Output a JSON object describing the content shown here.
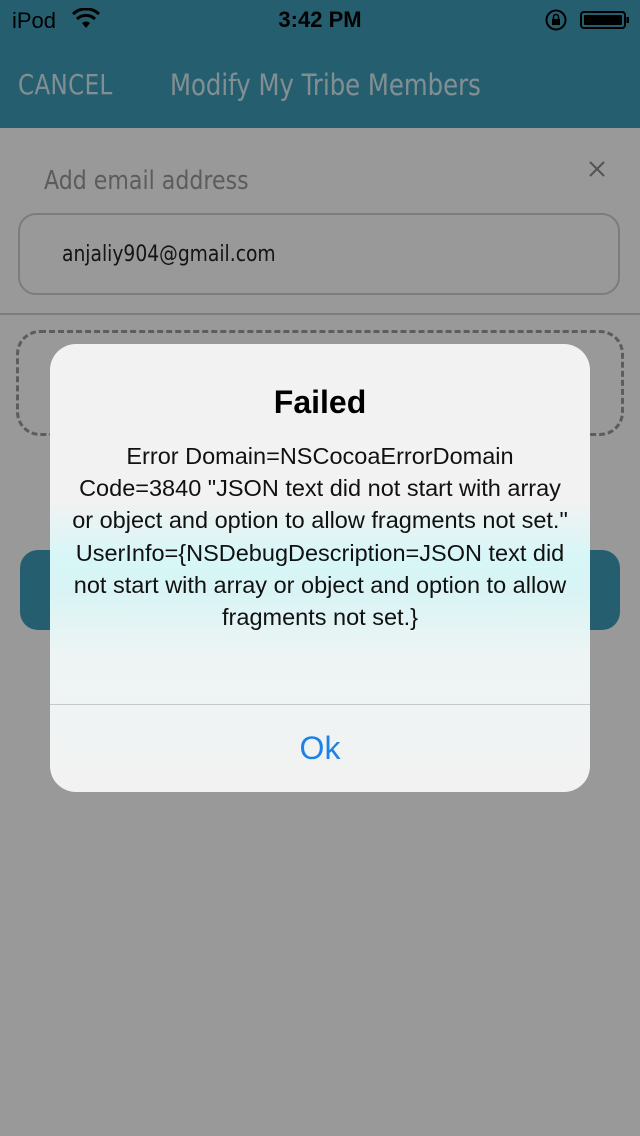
{
  "status_bar": {
    "carrier": "iPod",
    "time": "3:42 PM"
  },
  "nav": {
    "cancel_label": "CANCEL",
    "title": "Modify My Tribe Members"
  },
  "form": {
    "add_email_label": "Add email address",
    "email_value": "anjaliy904@gmail.com"
  },
  "alert": {
    "title": "Failed",
    "message": "Error Domain=NSCocoaErrorDomain Code=3840 \"JSON text did not start with array or object and option to allow fragments not set.\" UserInfo={NSDebugDescription=JSON text did not start with array or object and option to allow fragments not set.}",
    "ok_label": "Ok"
  },
  "colors": {
    "brand_teal": "#3f9fba",
    "alert_button_blue": "#1a82e8"
  }
}
